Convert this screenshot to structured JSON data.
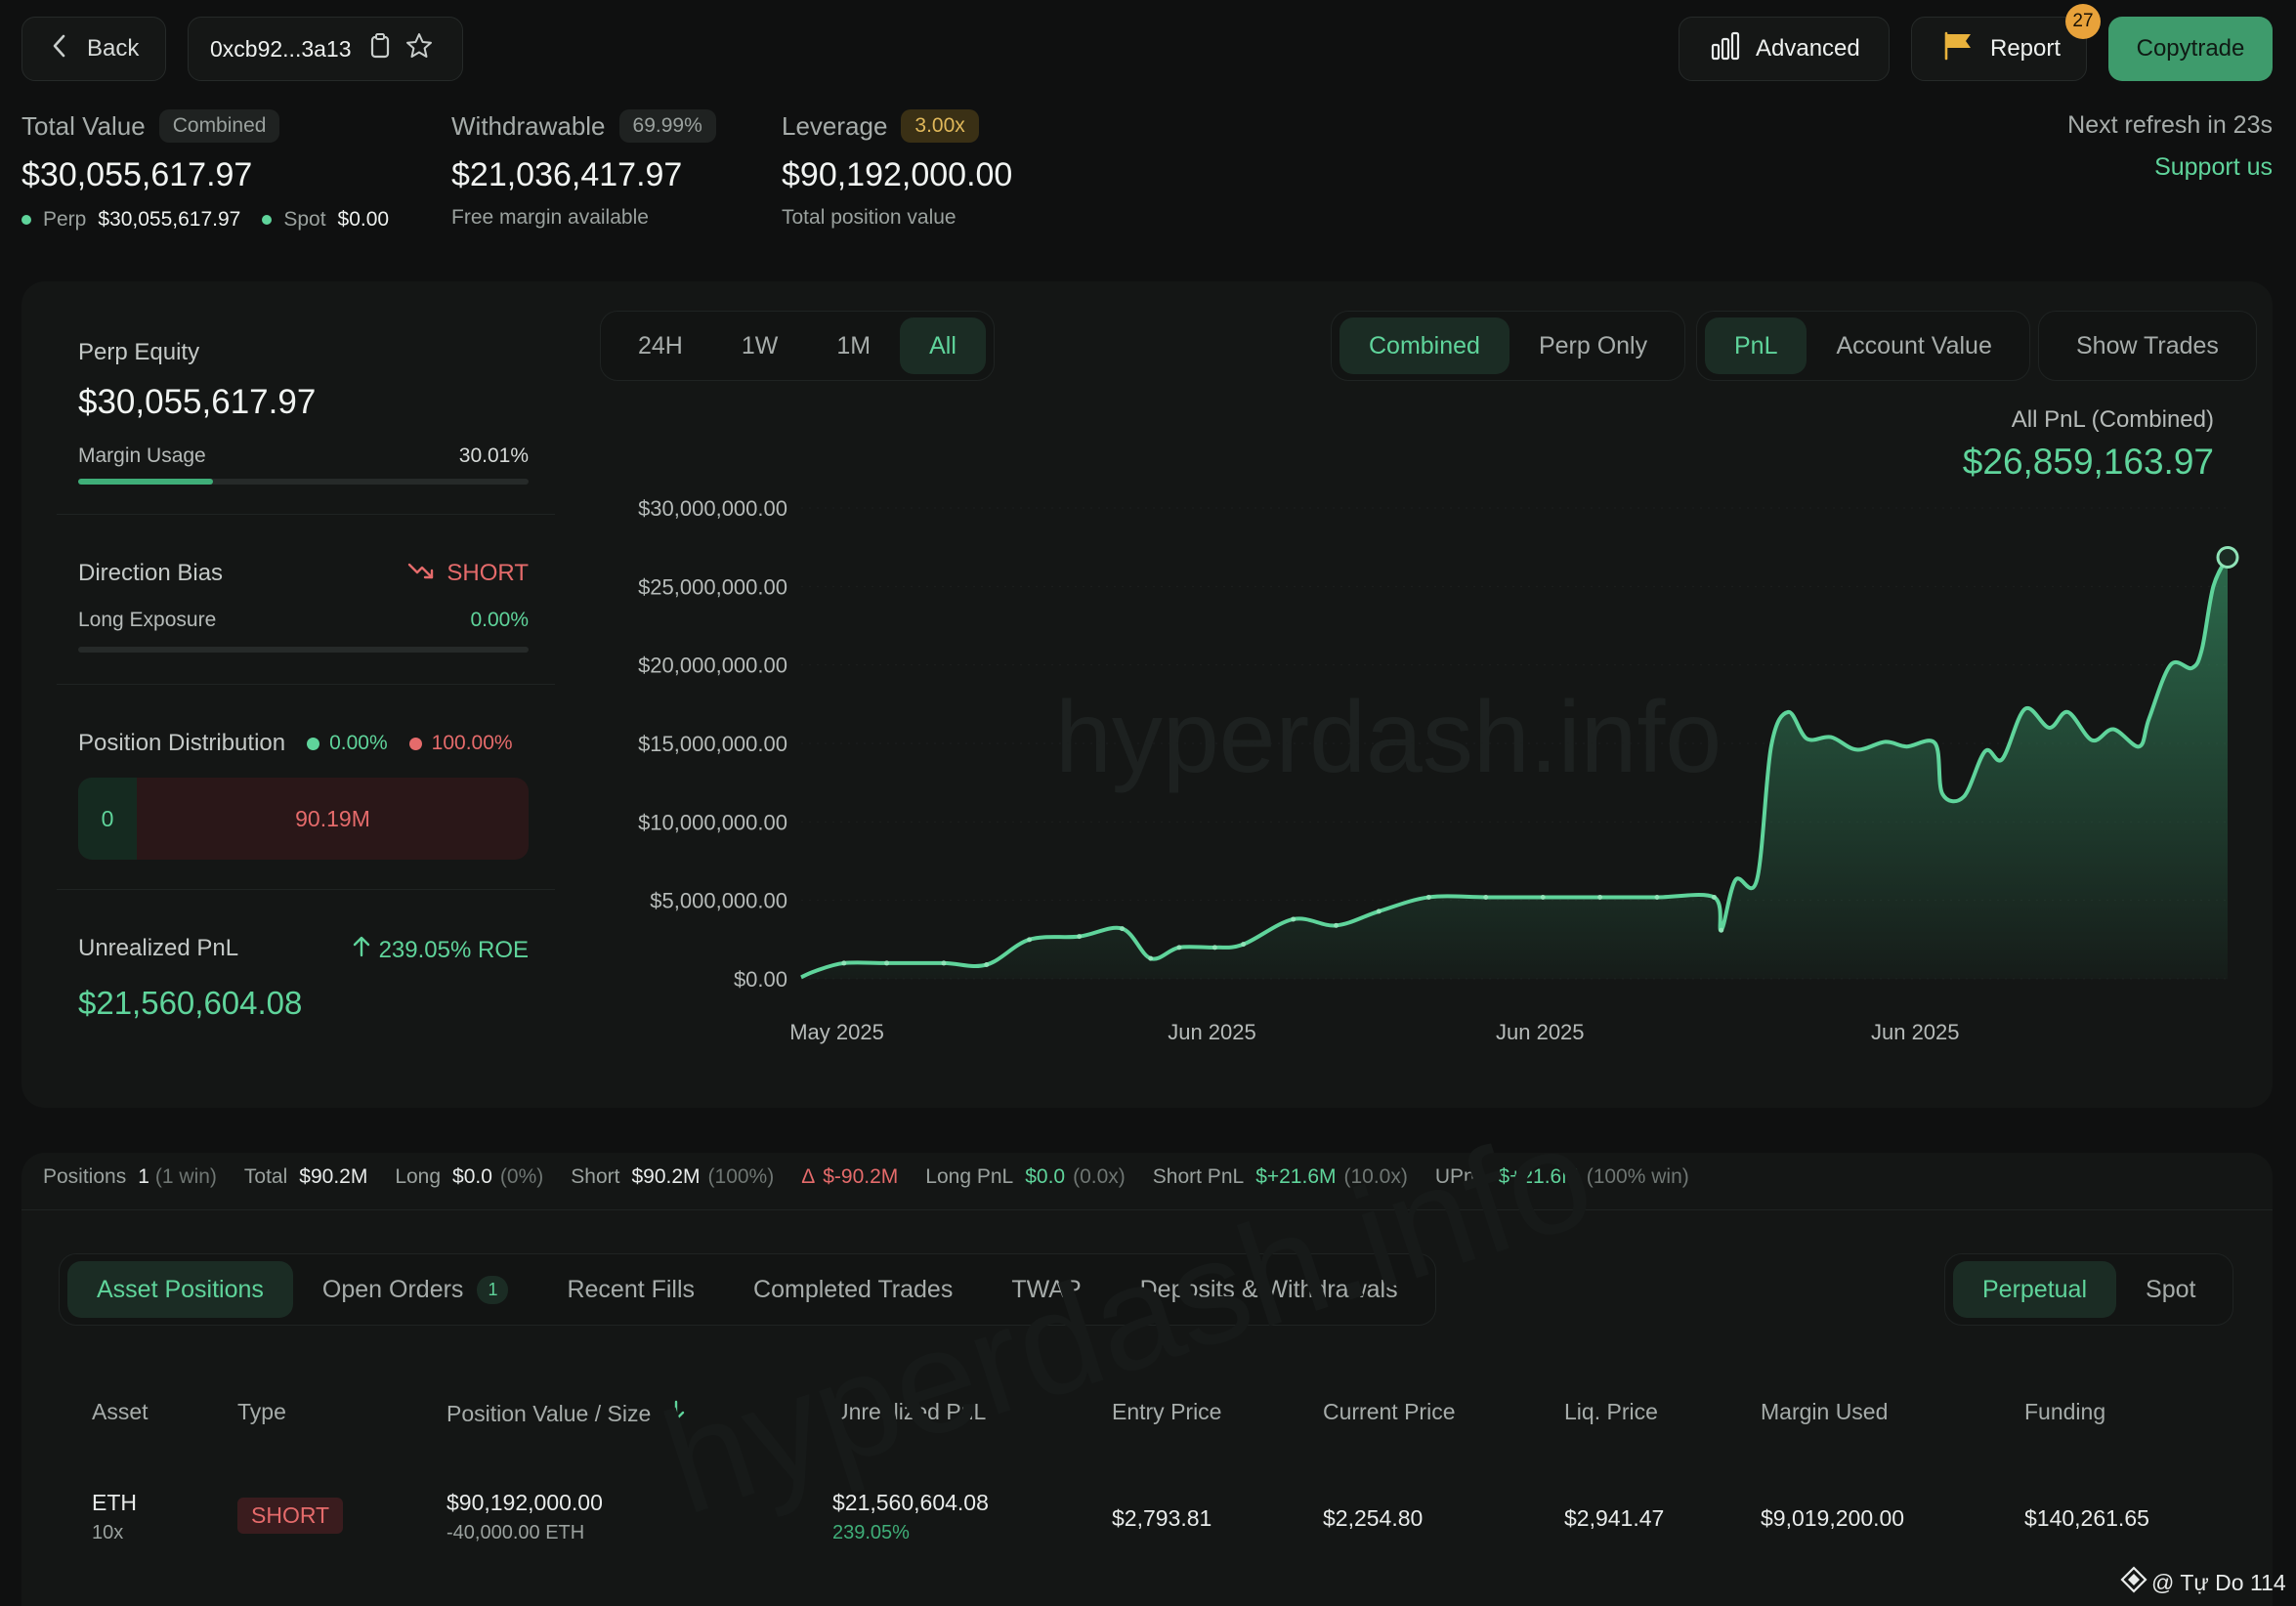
{
  "topbar": {
    "back_label": "Back",
    "address": "0xcb92...3a13",
    "advanced_label": "Advanced",
    "report_label": "Report",
    "report_count": "27",
    "copytrade_label": "Copytrade"
  },
  "stats": {
    "total_value": {
      "label": "Total Value",
      "badge": "Combined",
      "value": "$30,055,617.97",
      "perp_label": "Perp",
      "perp_value": "$30,055,617.97",
      "spot_label": "Spot",
      "spot_value": "$0.00"
    },
    "withdrawable": {
      "label": "Withdrawable",
      "badge": "69.99%",
      "value": "$21,036,417.97",
      "sub": "Free margin available"
    },
    "leverage": {
      "label": "Leverage",
      "badge": "3.00x",
      "value": "$90,192,000.00",
      "sub": "Total position value"
    },
    "refresh": "Next refresh in 23s",
    "support": "Support us"
  },
  "left_panel": {
    "perp_equity_label": "Perp Equity",
    "perp_equity_value": "$30,055,617.97",
    "margin_usage_label": "Margin Usage",
    "margin_usage_value": "30.01%",
    "margin_usage_fraction": 0.3001,
    "direction_bias_label": "Direction Bias",
    "direction_bias_value": "SHORT",
    "long_exposure_label": "Long Exposure",
    "long_exposure_value": "0.00%",
    "position_distribution_label": "Position Distribution",
    "dist_long_pct": "0.00%",
    "dist_short_pct": "100.00%",
    "dist_long_value": "0",
    "dist_short_value": "90.19M",
    "unrealized_pnl_label": "Unrealized PnL",
    "roe": "239.05% ROE",
    "unrealized_pnl_value": "$21,560,604.08"
  },
  "chart_controls": {
    "ranges": [
      "24H",
      "1W",
      "1M",
      "All"
    ],
    "active_range": "All",
    "modes": [
      "Combined",
      "Perp Only"
    ],
    "metrics": [
      "PnL",
      "Account Value"
    ],
    "show_trades": "Show Trades"
  },
  "chart_header": {
    "label": "All PnL (Combined)",
    "value": "$26,859,163.97",
    "watermark": "hyperdash.info"
  },
  "chart_data": {
    "type": "area",
    "ylabels": [
      "$30,000,000.00",
      "$25,000,000.00",
      "$20,000,000.00",
      "$15,000,000.00",
      "$10,000,000.00",
      "$5,000,000.00",
      "$0.00"
    ],
    "xlabels": [
      {
        "t": 0.025,
        "label": "May 2025"
      },
      {
        "t": 0.288,
        "label": "Jun 2025"
      },
      {
        "t": 0.518,
        "label": "Jun 2025"
      },
      {
        "t": 0.781,
        "label": "Jun 2025"
      }
    ],
    "ylim": [
      0,
      30000000
    ],
    "line_color": "#5fd49b",
    "points": [
      [
        0.0,
        0.1
      ],
      [
        0.01,
        0.5
      ],
      [
        0.03,
        1.0
      ],
      [
        0.06,
        1.0
      ],
      [
        0.1,
        1.0
      ],
      [
        0.13,
        0.9
      ],
      [
        0.16,
        2.5
      ],
      [
        0.195,
        2.7
      ],
      [
        0.225,
        3.2
      ],
      [
        0.245,
        1.3
      ],
      [
        0.265,
        2.0
      ],
      [
        0.29,
        2.0
      ],
      [
        0.31,
        2.2
      ],
      [
        0.345,
        3.8
      ],
      [
        0.375,
        3.4
      ],
      [
        0.405,
        4.3
      ],
      [
        0.44,
        5.2
      ],
      [
        0.48,
        5.2
      ],
      [
        0.52,
        5.2
      ],
      [
        0.56,
        5.2
      ],
      [
        0.6,
        5.2
      ],
      [
        0.64,
        5.2
      ],
      [
        0.645,
        3.1
      ],
      [
        0.655,
        6.3
      ],
      [
        0.67,
        6.3
      ],
      [
        0.68,
        14.8
      ],
      [
        0.692,
        17.0
      ],
      [
        0.705,
        15.3
      ],
      [
        0.722,
        15.4
      ],
      [
        0.74,
        14.6
      ],
      [
        0.76,
        15.1
      ],
      [
        0.775,
        14.8
      ],
      [
        0.795,
        15.0
      ],
      [
        0.8,
        11.8
      ],
      [
        0.815,
        11.6
      ],
      [
        0.83,
        14.5
      ],
      [
        0.842,
        14.0
      ],
      [
        0.858,
        17.2
      ],
      [
        0.875,
        16.0
      ],
      [
        0.888,
        17.0
      ],
      [
        0.905,
        15.2
      ],
      [
        0.92,
        15.9
      ],
      [
        0.938,
        14.8
      ],
      [
        0.945,
        16.6
      ],
      [
        0.96,
        20.0
      ],
      [
        0.975,
        19.8
      ],
      [
        0.982,
        21.0
      ],
      [
        0.99,
        25.0
      ],
      [
        1.0,
        26.86
      ]
    ]
  },
  "summary_bar": {
    "positions_label": "Positions",
    "positions_value": "1",
    "positions_sub": "(1 win)",
    "total_label": "Total",
    "total_value": "$90.2M",
    "long_label": "Long",
    "long_value": "$0.0",
    "long_sub": "(0%)",
    "short_label": "Short",
    "short_value": "$90.2M",
    "short_sub": "(100%)",
    "delta_label": "Δ",
    "delta_value": "$-90.2M",
    "long_pnl_label": "Long PnL",
    "long_pnl_value": "$0.0",
    "long_pnl_sub": "(0.0x)",
    "short_pnl_label": "Short PnL",
    "short_pnl_value": "$+21.6M",
    "short_pnl_sub": "(10.0x)",
    "upnl_label": "UPnL",
    "upnl_value": "$+21.6M",
    "upnl_sub": "(100% win)"
  },
  "tabs": {
    "items": [
      "Asset Positions",
      "Open Orders",
      "Recent Fills",
      "Completed Trades",
      "TWAP",
      "Deposits & Withdrawals"
    ],
    "open_orders_count": "1",
    "market": [
      "Perpetual",
      "Spot"
    ]
  },
  "table": {
    "headers": [
      "Asset",
      "Type",
      "Position Value / Size",
      "Unrealized PnL",
      "Entry Price",
      "Current Price",
      "Liq. Price",
      "Margin Used",
      "Funding"
    ],
    "rows": [
      {
        "asset": "ETH",
        "lev": "10x",
        "type": "SHORT",
        "value": "$90,192,000.00",
        "size": "-40,000.00 ETH",
        "upnl": "$21,560,604.08",
        "upnl_pct": "239.05%",
        "entry": "$2,793.81",
        "current": "$2,254.80",
        "liq": "$2,941.47",
        "margin": "$9,019,200.00",
        "funding": "$140,261.65"
      }
    ]
  },
  "footer": {
    "credit": "@ Tự Do 114"
  }
}
